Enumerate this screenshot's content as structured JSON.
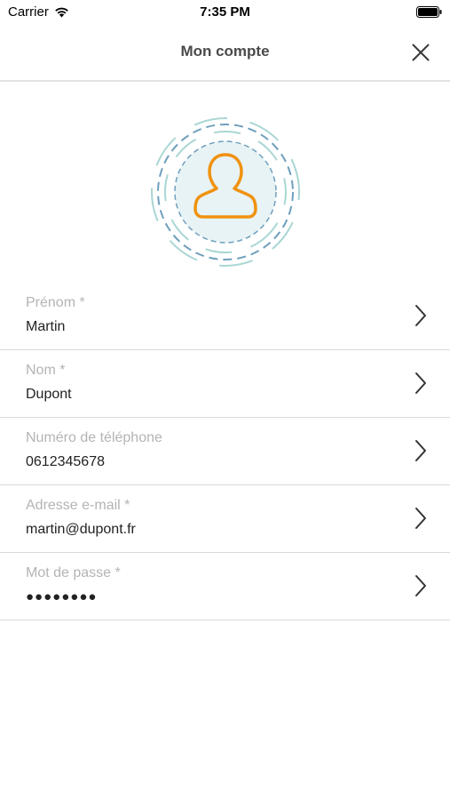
{
  "status_bar": {
    "carrier": "Carrier",
    "time": "7:35 PM",
    "wifi_icon": "wifi-icon",
    "battery_icon": "battery-icon"
  },
  "nav": {
    "title": "Mon compte",
    "close_icon": "close-icon"
  },
  "avatar": {
    "icon": "user-avatar-icon",
    "icon_color": "#f0920f",
    "ring_color": "#5a8fb0",
    "fill_color": "#e8f3f6"
  },
  "fields": [
    {
      "label": "Prénom *",
      "value": "Martin"
    },
    {
      "label": "Nom *",
      "value": "Dupont"
    },
    {
      "label": "Numéro de téléphone",
      "value": "0612345678"
    },
    {
      "label": "Adresse e-mail *",
      "value": "martin@dupont.fr"
    },
    {
      "label": "Mot de passe *",
      "value": "●●●●●●●●"
    }
  ]
}
